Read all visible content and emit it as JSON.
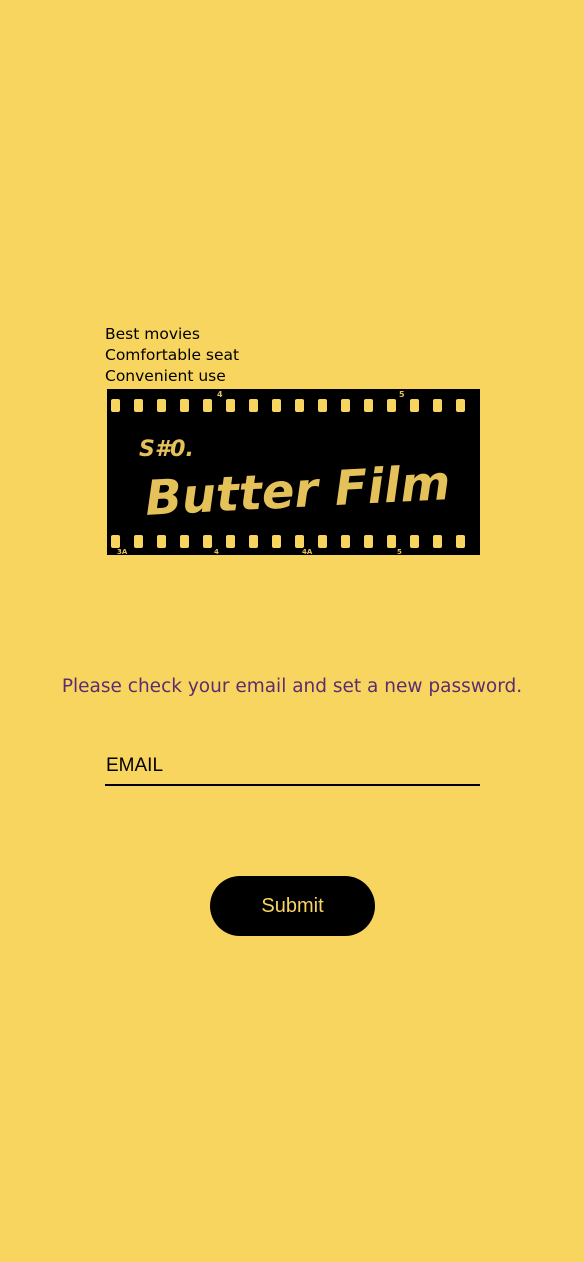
{
  "colors": {
    "background": "#F8D55E",
    "logo_gold": "#E5C15A",
    "message_text": "#5B2D6E",
    "button_text": "#F8D55E"
  },
  "taglines": [
    "Best movies",
    "Comfortable seat",
    "Convenient use"
  ],
  "logo": {
    "small_text": "S#0.",
    "brand_text": "Butter Film",
    "frame_numbers_top": [
      "4",
      "5"
    ],
    "frame_numbers_bottom": [
      "3A",
      "4",
      "4A",
      "5"
    ]
  },
  "message": "Please check your email and set a new password.",
  "email_field": {
    "placeholder": "EMAIL",
    "value": ""
  },
  "submit_label": "Submit"
}
